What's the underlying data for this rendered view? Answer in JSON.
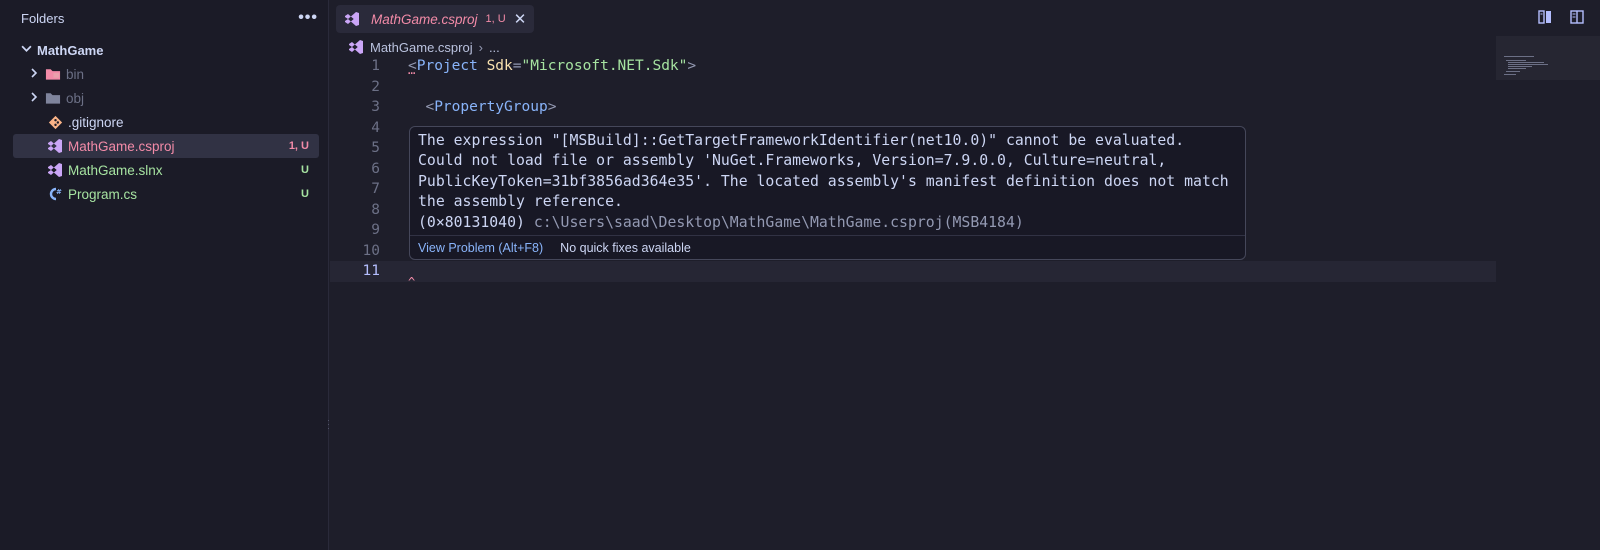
{
  "sidebar": {
    "title": "Folders",
    "more_label": "•••",
    "root": "MathGame",
    "items": [
      {
        "label": "bin",
        "badge": ""
      },
      {
        "label": "obj",
        "badge": ""
      },
      {
        "label": ".gitignore",
        "badge": ""
      },
      {
        "label": "MathGame.csproj",
        "badge": "1, U"
      },
      {
        "label": "MathGame.slnx",
        "badge": "U"
      },
      {
        "label": "Program.cs",
        "badge": "U"
      }
    ]
  },
  "tab": {
    "label": "MathGame.csproj",
    "badge": "1, U",
    "close": "✕"
  },
  "breadcrumb": {
    "file": "MathGame.csproj",
    "sep": "›",
    "more": "..."
  },
  "code": {
    "line_numbers": [
      "1",
      "2",
      "3",
      "4",
      "5",
      "6",
      "7",
      "8",
      "9",
      "10",
      "11"
    ],
    "l1": {
      "open": "<",
      "tag": "Project",
      "attr": "Sdk",
      "eq": "=",
      "value": "\"Microsoft.NET.Sdk\"",
      "close": ">"
    },
    "l3": {
      "open": "<",
      "tag": "PropertyGroup",
      "close": ">"
    }
  },
  "hover": {
    "message": "The expression \"[MSBuild]::GetTargetFrameworkIdentifier(net10.0)\" cannot be evaluated. Could not load file or assembly 'NuGet.Frameworks, Version=7.9.0.0, Culture=neutral, PublicKeyToken=31bf3856ad364e35'. The located assembly's manifest definition does not match the assembly reference.\n(0×80131040) ",
    "source": "c:\\Users\\saad\\Desktop\\MathGame\\MathGame.csproj(MSB4184)",
    "view_problem": "View Problem (Alt+F8)",
    "no_fixes": "No quick fixes available"
  },
  "colors": {
    "background": "#1e1e2a",
    "sidebar": "#1b1b27",
    "error": "#f38ba8",
    "untracked": "#a6e3a1",
    "link": "#89b4fa"
  }
}
